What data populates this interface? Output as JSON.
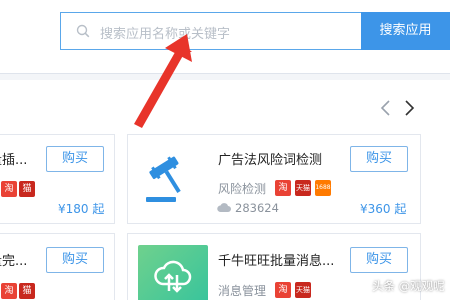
{
  "search": {
    "placeholder": "搜索应用名称或关键字",
    "button_label": "搜索应用"
  },
  "cards": {
    "top_left": {
      "title_partial": "量插...",
      "buy_label": "购买",
      "price": "¥180",
      "price_unit": "起"
    },
    "top_right": {
      "title": "广告法风险词检测",
      "category": "风险检测",
      "downloads": "283624",
      "buy_label": "购买",
      "price": "¥360",
      "price_unit": "起",
      "badges": [
        "淘",
        "天猫",
        "1688"
      ]
    },
    "bottom_left": {
      "title_partial": "量完...",
      "buy_label": "购买"
    },
    "bottom_right": {
      "title": "千牛旺旺批量消息...",
      "category": "消息管理",
      "buy_label": "购买",
      "badges": [
        "淘",
        "天猫"
      ]
    }
  },
  "icons": {
    "search": "magnifier-icon",
    "prev": "chevron-left-icon",
    "next": "chevron-right-icon",
    "gavel": "gavel-icon",
    "cloud": "cloud-sync-icon",
    "download": "cloud-download-icon"
  },
  "colors": {
    "accent": "#3d95e8",
    "arrow": "#e8342a",
    "border": "#e3e7ee",
    "tile_green": "#4ccb93"
  },
  "watermark": "头条 @观观呢"
}
